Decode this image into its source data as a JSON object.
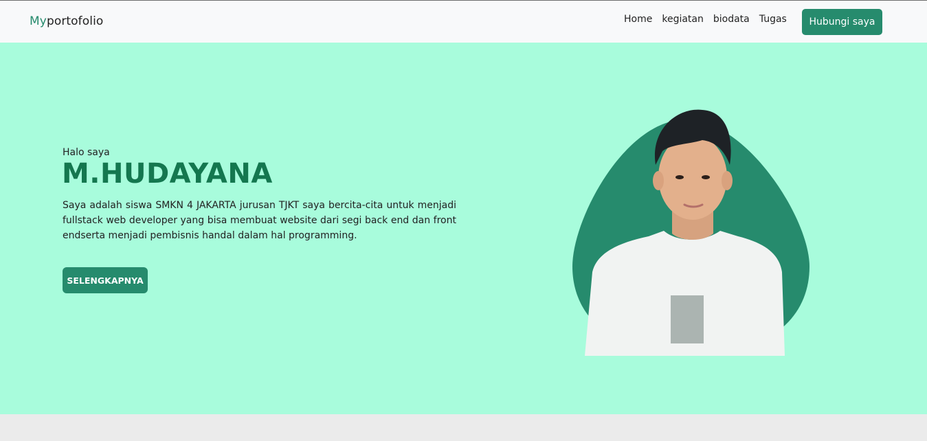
{
  "navbar": {
    "brand_accent": "My",
    "brand_rest": "portofolio",
    "links": [
      {
        "label": "Home"
      },
      {
        "label": "kegiatan"
      },
      {
        "label": "biodata"
      },
      {
        "label": "Tugas"
      }
    ],
    "cta_label": "Hubungi saya"
  },
  "hero": {
    "greeting": "Halo saya",
    "name": "M.HUDAYANA",
    "description": "Saya adalah siswa SMKN 4 JAKARTA jurusan TJKT saya bercita-cita untuk menjadi fullstack web developer yang bisa membuat website dari segi back end dan front endserta menjadi pembisnis handal dalam hal programming.",
    "button_label": "SELENGKAPNYA"
  },
  "colors": {
    "accent": "#268b6d",
    "name_color": "#14774f",
    "hero_background": "#a8fcdc",
    "navbar_background": "#f8f9fa",
    "page_background": "#ebebeb"
  }
}
